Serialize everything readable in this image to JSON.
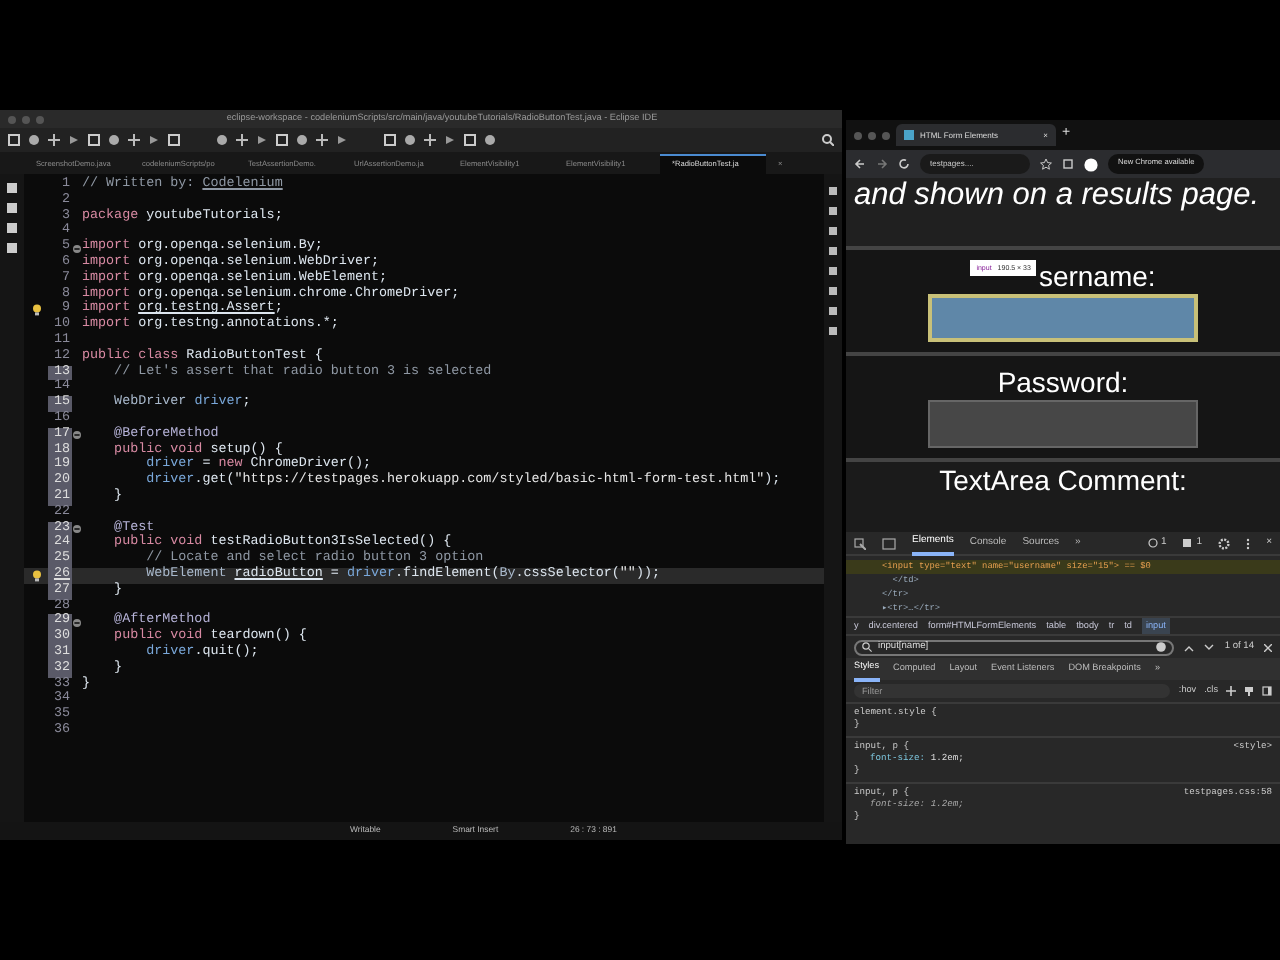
{
  "eclipse": {
    "title": "eclipse-workspace - codeleniumScripts/src/main/java/youtubeTutorials/RadioButtonTest.java - Eclipse IDE",
    "tabs": [
      {
        "label": "ScreenshotDemo.java",
        "selected": false
      },
      {
        "label": "codeleniumScripts/po",
        "selected": false
      },
      {
        "label": "TestAssertionDemo.",
        "selected": false
      },
      {
        "label": "UrlAssertionDemo.ja",
        "selected": false
      },
      {
        "label": "ElementVisibility1",
        "selected": false
      },
      {
        "label": "ElementVisibility1",
        "selected": false
      },
      {
        "label": "*RadioButtonTest.ja",
        "selected": true
      }
    ],
    "close_tab": "×",
    "code_lines": [
      {
        "number": "1",
        "changed": false,
        "current": false,
        "warning": false,
        "fold": false,
        "tokens": [
          {
            "kind": "comment",
            "text": "// Written by: "
          },
          {
            "kind": "commentlink",
            "text": "Codelenium"
          }
        ]
      },
      {
        "number": "2",
        "changed": false,
        "current": false,
        "warning": false,
        "fold": false
      },
      {
        "number": "3",
        "changed": false,
        "current": false,
        "warning": false,
        "fold": false,
        "tokens": [
          {
            "kind": "keyword",
            "text": "package"
          },
          {
            "kind": "plain",
            "text": " youtubeTutorials;"
          }
        ]
      },
      {
        "number": "4",
        "changed": false,
        "current": false,
        "warning": false,
        "fold": false
      },
      {
        "number": "5",
        "changed": false,
        "current": false,
        "warning": false,
        "fold": true,
        "tokens": [
          {
            "kind": "keyword",
            "text": "import"
          },
          {
            "kind": "plain",
            "text": " org.openqa.selenium.By;"
          }
        ]
      },
      {
        "number": "6",
        "changed": false,
        "current": false,
        "warning": false,
        "fold": false,
        "tokens": [
          {
            "kind": "keyword",
            "text": "import"
          },
          {
            "kind": "plain",
            "text": " org.openqa.selenium.WebDriver;"
          }
        ]
      },
      {
        "number": "7",
        "changed": false,
        "current": false,
        "warning": false,
        "fold": false,
        "tokens": [
          {
            "kind": "keyword",
            "text": "import"
          },
          {
            "kind": "plain",
            "text": " org.openqa.selenium.WebElement;"
          }
        ]
      },
      {
        "number": "8",
        "changed": false,
        "current": false,
        "warning": false,
        "fold": false,
        "tokens": [
          {
            "kind": "keyword",
            "text": "import"
          },
          {
            "kind": "plain",
            "text": " org.openqa.selenium.chrome.ChromeDriver;"
          }
        ]
      },
      {
        "number": "9",
        "changed": false,
        "current": false,
        "warning": true,
        "fold": false,
        "tokens": [
          {
            "kind": "keyword",
            "text": "import "
          },
          {
            "kind": "underlined",
            "text": "org.testng.Assert"
          },
          {
            "kind": "plain",
            "text": ";"
          }
        ]
      },
      {
        "number": "10",
        "changed": false,
        "current": false,
        "warning": false,
        "fold": false,
        "tokens": [
          {
            "kind": "keyword",
            "text": "import"
          },
          {
            "kind": "plain",
            "text": " org.testng.annotations.*;"
          }
        ]
      },
      {
        "number": "11",
        "changed": false,
        "current": false,
        "warning": false,
        "fold": false
      },
      {
        "number": "12",
        "changed": false,
        "current": false,
        "warning": false,
        "fold": false,
        "tokens": [
          {
            "kind": "keyword",
            "text": "public class"
          },
          {
            "kind": "plain",
            "text": " RadioButtonTest {"
          }
        ]
      },
      {
        "number": "13",
        "changed": true,
        "current": false,
        "warning": false,
        "fold": false,
        "tokens": [
          {
            "kind": "comment",
            "text": "    // Let's assert that radio button 3 is selected"
          }
        ]
      },
      {
        "number": "14",
        "changed": false,
        "current": false,
        "warning": false,
        "fold": false
      },
      {
        "number": "15",
        "changed": true,
        "current": false,
        "warning": false,
        "fold": false,
        "tokens": [
          {
            "kind": "type",
            "text": "    WebDriver "
          },
          {
            "kind": "field",
            "text": "driver"
          },
          {
            "kind": "plain",
            "text": ";"
          }
        ]
      },
      {
        "number": "16",
        "changed": false,
        "current": false,
        "warning": false,
        "fold": false
      },
      {
        "number": "17",
        "changed": true,
        "current": false,
        "warning": false,
        "fold": true,
        "tokens": [
          {
            "kind": "annotation",
            "text": "    @BeforeMethod"
          }
        ]
      },
      {
        "number": "18",
        "changed": true,
        "current": false,
        "warning": false,
        "fold": false,
        "tokens": [
          {
            "kind": "keyword",
            "text": "    public void"
          },
          {
            "kind": "plain",
            "text": " setup() {"
          }
        ]
      },
      {
        "number": "19",
        "changed": true,
        "current": false,
        "warning": false,
        "fold": false,
        "tokens": [
          {
            "kind": "field",
            "text": "        driver"
          },
          {
            "kind": "plain",
            "text": " = "
          },
          {
            "kind": "keyword",
            "text": "new"
          },
          {
            "kind": "plain",
            "text": " ChromeDriver();"
          }
        ]
      },
      {
        "number": "20",
        "changed": true,
        "current": false,
        "warning": false,
        "fold": false,
        "tokens": [
          {
            "kind": "field",
            "text": "        driver"
          },
          {
            "kind": "plain",
            "text": ".get("
          },
          {
            "kind": "string",
            "text": "\"https://testpages.herokuapp.com/styled/basic-html-form-test.html\""
          },
          {
            "kind": "plain",
            "text": ");"
          }
        ]
      },
      {
        "number": "21",
        "changed": true,
        "current": false,
        "warning": false,
        "fold": false,
        "tokens": [
          {
            "kind": "plain",
            "text": "    }"
          }
        ]
      },
      {
        "number": "22",
        "changed": false,
        "current": false,
        "warning": false,
        "fold": false
      },
      {
        "number": "23",
        "changed": true,
        "current": false,
        "warning": false,
        "fold": true,
        "tokens": [
          {
            "kind": "annotation",
            "text": "    @Test"
          }
        ]
      },
      {
        "number": "24",
        "changed": true,
        "current": false,
        "warning": false,
        "fold": false,
        "tokens": [
          {
            "kind": "keyword",
            "text": "    public void"
          },
          {
            "kind": "plain",
            "text": " testRadioButton3IsSelected() {"
          }
        ]
      },
      {
        "number": "25",
        "changed": true,
        "current": false,
        "warning": false,
        "fold": false,
        "tokens": [
          {
            "kind": "comment",
            "text": "        // Locate and select radio button 3 option"
          }
        ]
      },
      {
        "number": "26",
        "changed": true,
        "current": true,
        "warning": true,
        "fold": false,
        "tokens": [
          {
            "kind": "type",
            "text": "        WebElement "
          },
          {
            "kind": "underlined",
            "text": "radioButton"
          },
          {
            "kind": "plain",
            "text": " = "
          },
          {
            "kind": "field",
            "text": "driver"
          },
          {
            "kind": "plain",
            "text": ".findElement("
          },
          {
            "kind": "type",
            "text": "By"
          },
          {
            "kind": "plain",
            "text": ".cssSelector("
          },
          {
            "kind": "string",
            "text": "\"\""
          },
          {
            "kind": "plain",
            "text": "));"
          }
        ]
      },
      {
        "number": "27",
        "changed": true,
        "current": false,
        "warning": false,
        "fold": false,
        "tokens": [
          {
            "kind": "plain",
            "text": "    }"
          }
        ]
      },
      {
        "number": "28",
        "changed": false,
        "current": false,
        "warning": false,
        "fold": false
      },
      {
        "number": "29",
        "changed": true,
        "current": false,
        "warning": false,
        "fold": true,
        "tokens": [
          {
            "kind": "annotation",
            "text": "    @AfterMethod"
          }
        ]
      },
      {
        "number": "30",
        "changed": true,
        "current": false,
        "warning": false,
        "fold": false,
        "tokens": [
          {
            "kind": "keyword",
            "text": "    public void"
          },
          {
            "kind": "plain",
            "text": " teardown() {"
          }
        ]
      },
      {
        "number": "31",
        "changed": true,
        "current": false,
        "warning": false,
        "fold": false,
        "tokens": [
          {
            "kind": "field",
            "text": "        driver"
          },
          {
            "kind": "plain",
            "text": ".quit();"
          }
        ]
      },
      {
        "number": "32",
        "changed": true,
        "current": false,
        "warning": false,
        "fold": false,
        "tokens": [
          {
            "kind": "plain",
            "text": "    }"
          }
        ]
      },
      {
        "number": "33",
        "changed": false,
        "current": false,
        "warning": false,
        "fold": false,
        "tokens": [
          {
            "kind": "plain",
            "text": "}"
          }
        ]
      },
      {
        "number": "34",
        "changed": false,
        "current": false,
        "warning": false,
        "fold": false
      },
      {
        "number": "35",
        "changed": false,
        "current": false,
        "warning": false,
        "fold": false
      },
      {
        "number": "36",
        "changed": false,
        "current": false,
        "warning": false,
        "fold": false
      }
    ],
    "status_bar": [
      "Writable",
      "Smart Insert",
      "26 : 73 : 891"
    ]
  },
  "browser": {
    "tab_title": "HTML Form Elements",
    "tab_close": "×",
    "new_tab": "+",
    "address": "testpages....",
    "update_button": "New Chrome available",
    "page": {
      "intro": "and shown on a results page.",
      "fields": [
        {
          "label": "sername:",
          "highlighted": true
        },
        {
          "label": "Password:",
          "highlighted": false
        }
      ],
      "last_label": "TextArea Comment:",
      "tooltip": {
        "tag": "input",
        "size": "190.5 × 33"
      }
    }
  },
  "devtools": {
    "tabs": [
      {
        "label": "Elements",
        "selected": true
      },
      {
        "label": "Console",
        "selected": false
      },
      {
        "label": "Sources",
        "selected": false
      },
      {
        "label": "»",
        "selected": false
      }
    ],
    "errors": "1",
    "messages": "1",
    "close": "×",
    "dom_lines": [
      {
        "text": "<input type=\"text\" name=\"username\" size=\"15\"> == $0",
        "selected": true
      },
      {
        "text": "  </td>",
        "selected": false
      },
      {
        "text": "</tr>",
        "selected": false
      },
      {
        "text": "▸<tr>…</tr>",
        "selected": false
      }
    ],
    "breadcrumbs": [
      {
        "label": "y",
        "selected": false
      },
      {
        "label": "div.centered",
        "selected": false
      },
      {
        "label": "form#HTMLFormElements",
        "selected": false
      },
      {
        "label": "table",
        "selected": false
      },
      {
        "label": "tbody",
        "selected": false
      },
      {
        "label": "tr",
        "selected": false
      },
      {
        "label": "td",
        "selected": false
      },
      {
        "label": "input",
        "selected": true
      }
    ],
    "search": {
      "value": "input[name]",
      "count": "1 of 14"
    },
    "style_tabs": [
      {
        "label": "Styles",
        "selected": true
      },
      {
        "label": "Computed",
        "selected": false
      },
      {
        "label": "Layout",
        "selected": false
      },
      {
        "label": "Event Listeners",
        "selected": false
      },
      {
        "label": "DOM Breakpoints",
        "selected": false
      },
      {
        "label": "»",
        "selected": false
      }
    ],
    "filter": {
      "placeholder": "Filter",
      "hov": ":hov",
      "cls": ".cls"
    },
    "rules": [
      {
        "selector": "element.style {",
        "close": "}"
      },
      {
        "selector": "input, p {",
        "source": "<style>",
        "declarations": [
          {
            "property": "font-size:",
            "value": "1.2em;",
            "overridden": false
          }
        ],
        "close": "}"
      },
      {
        "selector": "input, p {",
        "source": "testpages.css:58",
        "declarations": [
          {
            "property": "font-size:",
            "value": "1.2em;",
            "overridden": true
          }
        ],
        "close": "}"
      }
    ]
  }
}
